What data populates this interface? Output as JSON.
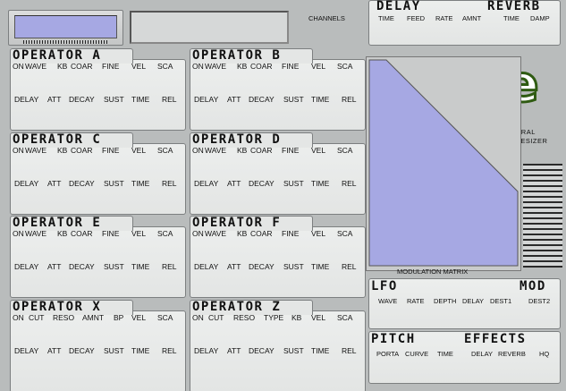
{
  "top": {
    "channels_label": "CHANNELS"
  },
  "operators": [
    {
      "title": "OPERATOR A",
      "row1": [
        "ON",
        "WAVE",
        "KB",
        "COAR",
        "FINE",
        "VEL",
        "SCA"
      ],
      "row2": [
        "DELAY",
        "ATT",
        "DECAY",
        "SUST",
        "TIME",
        "REL"
      ]
    },
    {
      "title": "OPERATOR B",
      "row1": [
        "ON",
        "WAVE",
        "KB",
        "COAR",
        "FINE",
        "VEL",
        "SCA"
      ],
      "row2": [
        "DELAY",
        "ATT",
        "DECAY",
        "SUST",
        "TIME",
        "REL"
      ]
    },
    {
      "title": "OPERATOR C",
      "row1": [
        "ON",
        "WAVE",
        "KB",
        "COAR",
        "FINE",
        "VEL",
        "SCA"
      ],
      "row2": [
        "DELAY",
        "ATT",
        "DECAY",
        "SUST",
        "TIME",
        "REL"
      ]
    },
    {
      "title": "OPERATOR D",
      "row1": [
        "ON",
        "WAVE",
        "KB",
        "COAR",
        "FINE",
        "VEL",
        "SCA"
      ],
      "row2": [
        "DELAY",
        "ATT",
        "DECAY",
        "SUST",
        "TIME",
        "REL"
      ]
    },
    {
      "title": "OPERATOR E",
      "row1": [
        "ON",
        "WAVE",
        "KB",
        "COAR",
        "FINE",
        "VEL",
        "SCA"
      ],
      "row2": [
        "DELAY",
        "ATT",
        "DECAY",
        "SUST",
        "TIME",
        "REL"
      ]
    },
    {
      "title": "OPERATOR F",
      "row1": [
        "ON",
        "WAVE",
        "KB",
        "COAR",
        "FINE",
        "VEL",
        "SCA"
      ],
      "row2": [
        "DELAY",
        "ATT",
        "DECAY",
        "SUST",
        "TIME",
        "REL"
      ]
    },
    {
      "title": "OPERATOR X",
      "row1": [
        "ON",
        "CUT",
        "RESO",
        "AMNT",
        "BP",
        "VEL",
        "SCA"
      ],
      "row2": [
        "DELAY",
        "ATT",
        "DECAY",
        "SUST",
        "TIME",
        "REL"
      ]
    },
    {
      "title": "OPERATOR Z",
      "row1": [
        "ON",
        "CUT",
        "RESO",
        "TYPE",
        "KB",
        "VEL",
        "SCA"
      ],
      "row2": [
        "DELAY",
        "ATT",
        "DECAY",
        "SUST",
        "TIME",
        "REL"
      ]
    }
  ],
  "delay_reverb": {
    "delay_title": "DELAY",
    "reverb_title": "REVERB",
    "labels": [
      "TIME",
      "FEED",
      "RATE",
      "AMNT",
      "TIME",
      "DAMP"
    ]
  },
  "logo": {
    "wordmark": "ôxe",
    "line1": "MULTI  TIMBRAL",
    "line2": "FM  SYNTHESIZER"
  },
  "matrix": {
    "label": "MODULATION  MATRIX"
  },
  "lfo": {
    "lfo_title": "LFO",
    "mod_title": "MOD",
    "labels": [
      "WAVE",
      "RATE",
      "DEPTH",
      "DELAY",
      "DEST1",
      "DEST2"
    ]
  },
  "pitch": {
    "pitch_title": "PITCH",
    "effects_title": "EFFECTS",
    "labels": [
      "PORTA",
      "CURVE",
      "TIME",
      "DELAY",
      "REVERB",
      "HQ"
    ]
  },
  "colors": {
    "lcd": "#a6a8e3",
    "background": "#b9bcbc",
    "panel": "#e8eae9",
    "logo_green": "#2f5b12"
  }
}
